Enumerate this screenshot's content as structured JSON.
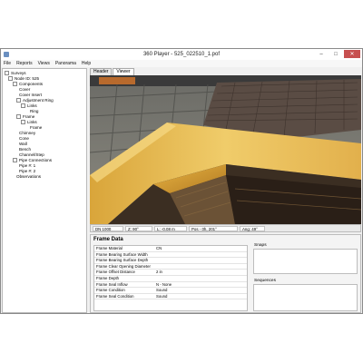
{
  "window": {
    "title": "360 Player - 525_022510_1.pof",
    "controls": [
      "–",
      "□",
      "✕"
    ]
  },
  "menu": [
    "File",
    "Reports",
    "Views",
    "Panorama",
    "Help"
  ],
  "tree": {
    "items": [
      {
        "label": "Surveys",
        "level": 0
      },
      {
        "label": "Node ID: 525",
        "level": 1
      },
      {
        "label": "Components",
        "level": 2
      },
      {
        "label": "Cover",
        "level": 3
      },
      {
        "label": "Cover Insert",
        "level": 3
      },
      {
        "label": "Adjustment Ring",
        "level": 3
      },
      {
        "label": "Links",
        "level": 4
      },
      {
        "label": "Ring",
        "level": 5
      },
      {
        "label": "Frame",
        "level": 3
      },
      {
        "label": "Links",
        "level": 4
      },
      {
        "label": "Frame",
        "level": 5
      },
      {
        "label": "Chimney",
        "level": 3
      },
      {
        "label": "Cone",
        "level": 3
      },
      {
        "label": "Wall",
        "level": 3
      },
      {
        "label": "Bench",
        "level": 3
      },
      {
        "label": "Channel/Step",
        "level": 3
      },
      {
        "label": "Pipe Connections",
        "level": 2
      },
      {
        "label": "Pipe #: 1",
        "level": 3
      },
      {
        "label": "Pipe #: 2",
        "level": 3
      },
      {
        "label": "Observations",
        "level": 2
      }
    ]
  },
  "tabs": [
    {
      "label": "Header",
      "active": false
    },
    {
      "label": "Viewer",
      "active": true
    }
  ],
  "status": {
    "dn": "DN 1000",
    "z": "Z: 90°",
    "l": "L: -0.08 m",
    "pos": "Pos - 0h, 201°",
    "ang": "Ang: 49°"
  },
  "frame_data": {
    "title": "Frame Data",
    "rows": [
      {
        "key": "Frame Material",
        "value": "CN"
      },
      {
        "key": "Frame Bearing Surface Width",
        "value": ""
      },
      {
        "key": "Frame Bearing Surface Depth",
        "value": ""
      },
      {
        "key": "Frame Clear Opening Diameter",
        "value": ""
      },
      {
        "key": "Frame Offset Distance",
        "value": "2 in"
      },
      {
        "key": "Frame Depth",
        "value": ""
      },
      {
        "key": "Frame Seal Inflow",
        "value": "N - None"
      },
      {
        "key": "Frame Condition",
        "value": "Sound"
      },
      {
        "key": "Frame Seal Condition",
        "value": "Sound"
      }
    ],
    "snaps_label": "Snaps",
    "sequences_label": "Sequences"
  }
}
